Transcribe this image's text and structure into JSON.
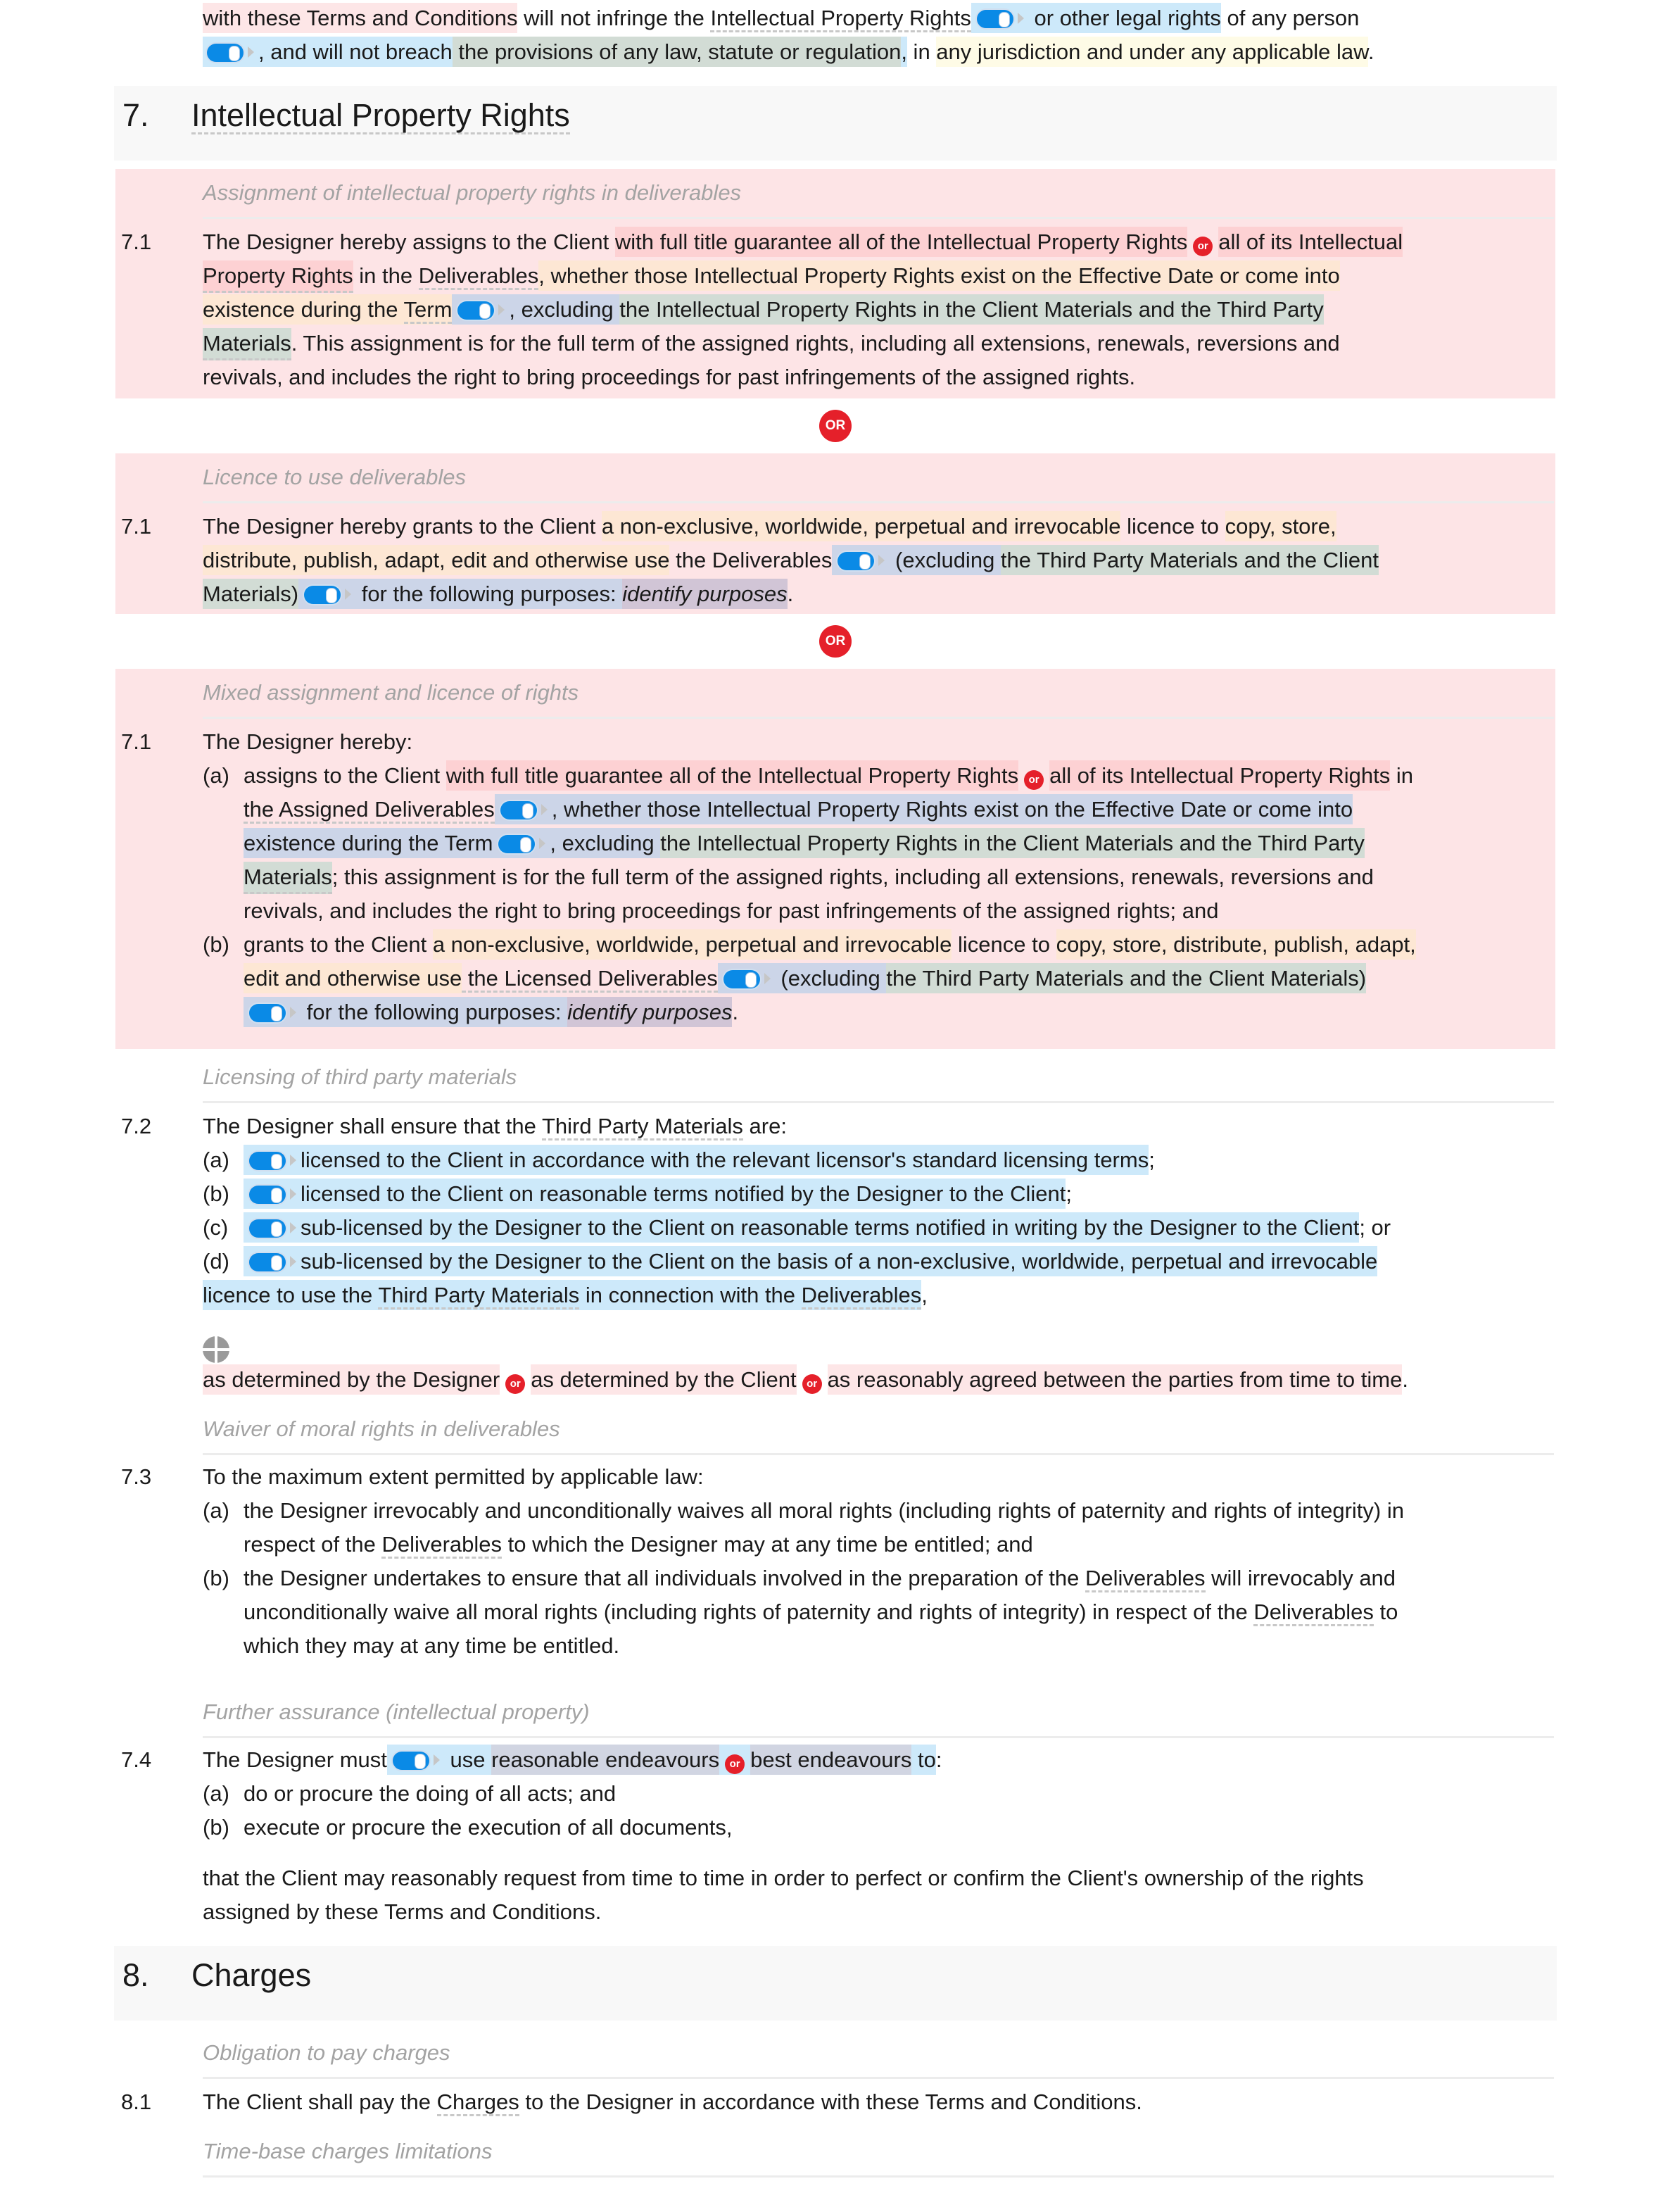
{
  "intro": {
    "line1_a": "with these Terms and Conditions",
    "line1_b": " will not infringe the ",
    "line1_c": "Intellectual Property Rights",
    "line1_d": " or other legal rights",
    "line1_e": " of any person",
    "line2_a": ", and will not breach",
    "line2_b": " the provisions of any law, statute or regulation",
    "line2_c": ",",
    "line2_d": " in ",
    "line2_e": "any jurisdiction and under any applicable law",
    "line2_f": "."
  },
  "section7": {
    "number": "7.",
    "title": "Intellectual Property Rights",
    "or_label": "OR",
    "or_small": "or",
    "alt1": {
      "subtitle": "Assignment of intellectual property rights in deliverables",
      "number": "7.1",
      "lines": [
        [
          "The Designer hereby assigns to the Client ",
          "with full title guarantee all of the Intellectual Property Rights",
          "all of its Intellectual"
        ],
        [
          "Property Rights",
          " in the ",
          "Deliverables",
          ", whether those Intellectual Property Rights exist on the Effective Date or come into"
        ],
        [
          "existence during the ",
          "Term",
          ", excluding ",
          "the Intellectual Property Rights in the Client Materials and the Third Party"
        ],
        [
          "Materials",
          ". This assignment is for the full term of the assigned rights, including all extensions, renewals, reversions and"
        ],
        [
          "revivals, and includes the right to bring proceedings for past infringements of the assigned rights."
        ]
      ]
    },
    "alt2": {
      "subtitle": "Licence to use deliverables",
      "number": "7.1",
      "lines": [
        [
          "The Designer hereby grants to the Client ",
          "a non-exclusive, worldwide, perpetual and irrevocable",
          " licence to ",
          "copy, store,"
        ],
        [
          "distribute, publish, adapt, edit and otherwise use",
          " the Deliverables",
          " (excluding ",
          "the Third Party Materials and the Client"
        ],
        [
          "Materials)",
          " for the following purposes: ",
          "identify purposes",
          "."
        ]
      ]
    },
    "alt3": {
      "subtitle": "Mixed assignment and licence of rights",
      "number": "7.1",
      "intro": "The Designer hereby:",
      "a_label": "(a)",
      "a_lines": [
        [
          "assigns to the Client ",
          "with full title guarantee all of the Intellectual Property Rights",
          "all of its Intellectual Property Rights",
          " in"
        ],
        [
          "the Assigned Deliverables",
          ", whether those Intellectual Property Rights exist on the Effective Date or come into"
        ],
        [
          "existence during the Term",
          ", excluding ",
          "the Intellectual Property Rights in the Client Materials and the Third Party"
        ],
        [
          "Materials",
          "; this assignment is for the full term of the assigned rights, including all extensions, renewals, reversions and"
        ],
        [
          "revivals, and includes the right to bring proceedings for past infringements of the assigned rights; and"
        ]
      ],
      "b_label": "(b)",
      "b_lines": [
        [
          "grants to the Client ",
          "a non-exclusive, worldwide, perpetual and irrevocable",
          " licence to ",
          "copy, store, distribute, publish, adapt,"
        ],
        [
          "edit and otherwise use",
          " the Licensed Deliverables",
          " (excluding ",
          "the Third Party Materials and the Client Materials)"
        ],
        [
          " for the following purposes: ",
          "identify purposes",
          "."
        ]
      ]
    },
    "c72": {
      "subtitle": "Licensing of third party materials",
      "number": "7.2",
      "intro_a": "The Designer shall ensure that the ",
      "intro_b": "Third Party Materials",
      "intro_c": " are:",
      "items": [
        {
          "label": "(a)",
          "text": "licensed to the Client in accordance with the relevant licensor's standard licensing terms",
          "tail": ";"
        },
        {
          "label": "(b)",
          "text": "licensed to the Client on reasonable terms notified by the Designer to the Client",
          "tail": ";"
        },
        {
          "label": "(c)",
          "text": "sub-licensed by the Designer to the Client on reasonable terms notified in writing by the Designer to the Client",
          "tail": "; or"
        },
        {
          "label": "(d)",
          "text": "sub-licensed by the Designer to the Client on the basis of a non-exclusive, worldwide, perpetual and irrevocable",
          "tail": ""
        }
      ],
      "d_cont_a": "licence to use the ",
      "d_cont_b": "Third Party Materials",
      "d_cont_c": " in connection with the ",
      "d_cont_d": "Deliverables",
      "d_cont_e": ",",
      "options": [
        "as determined by the Designer",
        "as determined by the Client",
        "as reasonably agreed between the parties from time to time"
      ],
      "options_tail": "."
    },
    "c73": {
      "subtitle": "Waiver of moral rights in deliverables",
      "number": "7.3",
      "intro": "To the maximum extent permitted by applicable law:",
      "a_label": "(a)",
      "a_l1": "the Designer irrevocably and unconditionally waives all moral rights (including rights of paternity and rights of integrity) in",
      "a_l2a": "respect of the ",
      "a_l2b": "Deliverables",
      "a_l2c": " to which the Designer may at any time be entitled; and",
      "b_label": "(b)",
      "b_l1a": "the Designer undertakes to ensure that all individuals involved in the preparation of the ",
      "b_l1b": "Deliverables",
      "b_l1c": " will irrevocably and",
      "b_l2a": "unconditionally waive all moral rights (including rights of paternity and rights of integrity) in respect of the ",
      "b_l2b": "Deliverables",
      "b_l2c": " to",
      "b_l3": "which they may at any time be entitled."
    },
    "c74": {
      "subtitle": "Further assurance (intellectual property)",
      "number": "7.4",
      "l1a": "The Designer must",
      "l1b": " use ",
      "l1c": "reasonable endeavours",
      "l1d": "best endeavours",
      "l1e": " to",
      "l1f": ":",
      "a_label": "(a)",
      "a_text": "do or procure the doing of all acts; and",
      "b_label": "(b)",
      "b_text": "execute or procure the execution of all documents,",
      "tail1": "that the Client may reasonably request from time to time in order to perfect or confirm the Client's ownership of the rights",
      "tail2": "assigned by these Terms and Conditions."
    }
  },
  "section8": {
    "number": "8.",
    "title": "Charges",
    "c81": {
      "subtitle": "Obligation to pay charges",
      "number": "8.1",
      "a": "The Client shall pay the ",
      "b": "Charges",
      "c": " to the Designer in accordance with these Terms and Conditions."
    },
    "next_subtitle": "Time-base charges limitations"
  }
}
